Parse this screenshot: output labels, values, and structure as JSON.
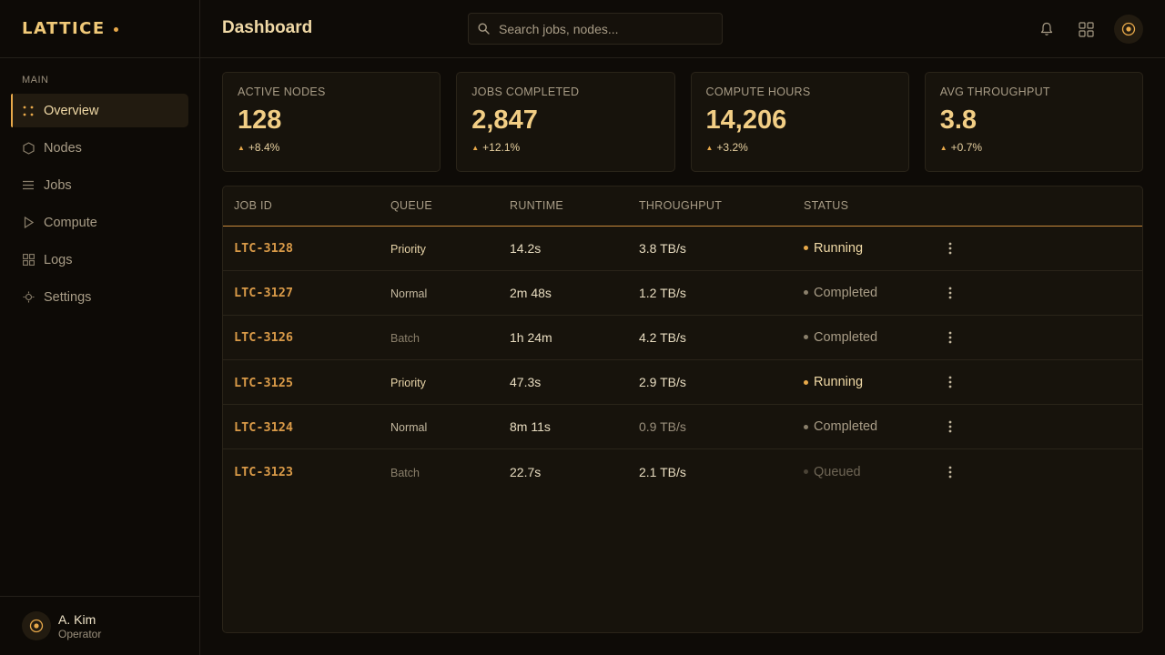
{
  "brand": {
    "name": "LATTICE"
  },
  "sidebar": {
    "section_label": "MAIN",
    "items": [
      {
        "label": "Overview",
        "icon": "dots-grid-icon",
        "active": true
      },
      {
        "label": "Nodes",
        "icon": "hexagon-icon"
      },
      {
        "label": "Jobs",
        "icon": "list-icon"
      },
      {
        "label": "Compute",
        "icon": "play-icon"
      },
      {
        "label": "Logs",
        "icon": "grid-icon"
      },
      {
        "label": "Settings",
        "icon": "gear-icon"
      }
    ]
  },
  "user": {
    "name": "A. Kim",
    "role": "Operator"
  },
  "header": {
    "title": "Dashboard",
    "search_placeholder": "Search jobs, nodes..."
  },
  "stats": [
    {
      "label": "ACTIVE NODES",
      "value": "128",
      "delta": "+8.4%"
    },
    {
      "label": "JOBS COMPLETED",
      "value": "2,847",
      "delta": "+12.1%"
    },
    {
      "label": "COMPUTE HOURS",
      "value": "14,206",
      "delta": "+3.2%"
    },
    {
      "label": "AVG THROUGHPUT",
      "value": "3.8",
      "delta": "+0.7%"
    }
  ],
  "table": {
    "columns": [
      "JOB ID",
      "QUEUE",
      "RUNTIME",
      "THROUGHPUT",
      "STATUS"
    ],
    "rows": [
      {
        "id": "LTC-3128",
        "queue": "Priority",
        "runtime": "14.2s",
        "throughput": "3.8 TB/s",
        "status": "Running"
      },
      {
        "id": "LTC-3127",
        "queue": "Normal",
        "runtime": "2m 48s",
        "throughput": "1.2 TB/s",
        "status": "Completed"
      },
      {
        "id": "LTC-3126",
        "queue": "Batch",
        "runtime": "1h 24m",
        "throughput": "4.2 TB/s",
        "status": "Completed"
      },
      {
        "id": "LTC-3125",
        "queue": "Priority",
        "runtime": "47.3s",
        "throughput": "2.9 TB/s",
        "status": "Running"
      },
      {
        "id": "LTC-3124",
        "queue": "Normal",
        "runtime": "8m 11s",
        "throughput": "0.9 TB/s",
        "status": "Completed"
      },
      {
        "id": "LTC-3123",
        "queue": "Batch",
        "runtime": "22.7s",
        "throughput": "2.1 TB/s",
        "status": "Queued"
      }
    ]
  },
  "colors": {
    "accent": "#e8a94a",
    "background": "#0e0b07",
    "card": "#17130c"
  }
}
